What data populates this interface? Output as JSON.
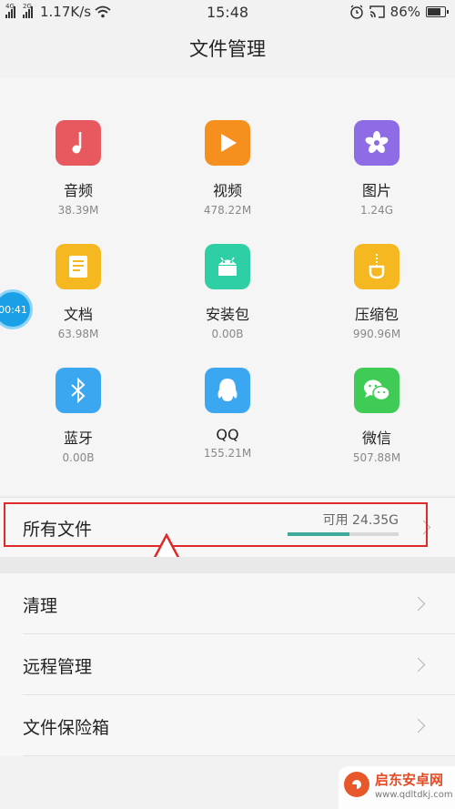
{
  "status_bar": {
    "net_speed": "1.17K/s",
    "time": "15:48",
    "battery": "86%",
    "signal1_tag": "4G",
    "signal2_tag": "2G"
  },
  "header": {
    "title": "文件管理"
  },
  "categories": [
    {
      "name": "音频",
      "size": "38.39M",
      "icon": "music-note-icon",
      "color": "#e8585f"
    },
    {
      "name": "视频",
      "size": "478.22M",
      "icon": "play-icon",
      "color": "#f5901f"
    },
    {
      "name": "图片",
      "size": "1.24G",
      "icon": "flower-icon",
      "color": "#8d6ce5"
    },
    {
      "name": "文档",
      "size": "63.98M",
      "icon": "document-icon",
      "color": "#f5b820"
    },
    {
      "name": "安装包",
      "size": "0.00B",
      "icon": "android-icon",
      "color": "#2fcfa5"
    },
    {
      "name": "压缩包",
      "size": "990.96M",
      "icon": "zip-icon",
      "color": "#f5b820"
    },
    {
      "name": "蓝牙",
      "size": "0.00B",
      "icon": "bluetooth-icon",
      "color": "#3ba7f0"
    },
    {
      "name": "QQ",
      "size": "155.21M",
      "icon": "qq-penguin-icon",
      "color": "#3ba7f0"
    },
    {
      "name": "微信",
      "size": "507.88M",
      "icon": "wechat-icon",
      "color": "#3fcb56"
    }
  ],
  "all_files": {
    "label": "所有文件",
    "available": "可用 24.35G",
    "used_fraction": 0.56
  },
  "menu": [
    {
      "label": "清理"
    },
    {
      "label": "远程管理"
    },
    {
      "label": "文件保险箱"
    }
  ],
  "floating_ball": {
    "text": "00:41"
  },
  "watermark": {
    "title": "启东安卓网",
    "url": "www.qdltdkj.com"
  }
}
